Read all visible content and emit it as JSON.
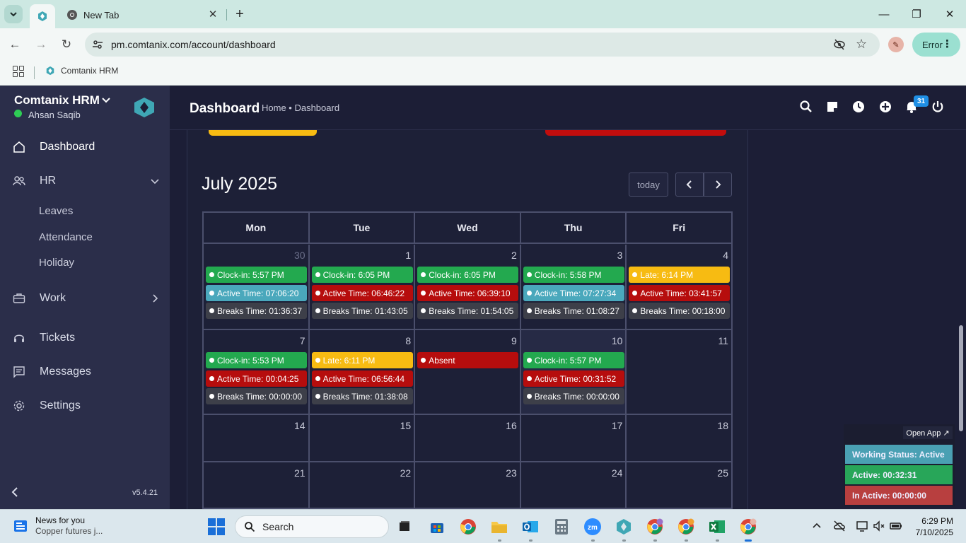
{
  "browser": {
    "tab_title": "New Tab",
    "url": "pm.comtanix.com/account/dashboard",
    "error_label": "Error",
    "bookmark": "Comtanix HRM"
  },
  "sidebar": {
    "brand": "Comtanix HRM",
    "user": "Ahsan Saqib",
    "items": [
      {
        "label": "Dashboard",
        "icon": "home-icon"
      },
      {
        "label": "HR",
        "icon": "users-icon"
      },
      {
        "label": "Leaves"
      },
      {
        "label": "Attendance"
      },
      {
        "label": "Holiday"
      },
      {
        "label": "Work",
        "icon": "briefcase-icon"
      },
      {
        "label": "Tickets",
        "icon": "headset-icon"
      },
      {
        "label": "Messages",
        "icon": "message-icon"
      },
      {
        "label": "Settings",
        "icon": "gear-icon"
      }
    ],
    "version": "v5.4.21"
  },
  "header": {
    "title": "Dashboard",
    "breadcrumb": "Home • Dashboard",
    "notification_count": "31"
  },
  "calendar": {
    "month": "July 2025",
    "today_label": "today",
    "weekdays": [
      "Mon",
      "Tue",
      "Wed",
      "Thu",
      "Fri"
    ],
    "weeks": [
      {
        "days": [
          {
            "num": "30",
            "events": [
              {
                "type": "green",
                "text": "Clock-in: 5:57 PM"
              },
              {
                "type": "teal",
                "text": "Active Time: 07:06:20"
              },
              {
                "type": "dark",
                "text": "Breaks Time: 01:36:37"
              }
            ]
          },
          {
            "num": "1",
            "events": [
              {
                "type": "green",
                "text": "Clock-in: 6:05 PM"
              },
              {
                "type": "red",
                "text": "Active Time: 06:46:22"
              },
              {
                "type": "dark",
                "text": "Breaks Time: 01:43:05"
              }
            ]
          },
          {
            "num": "2",
            "events": [
              {
                "type": "green",
                "text": "Clock-in: 6:05 PM"
              },
              {
                "type": "red",
                "text": "Active Time: 06:39:10"
              },
              {
                "type": "dark",
                "text": "Breaks Time: 01:54:05"
              }
            ]
          },
          {
            "num": "3",
            "events": [
              {
                "type": "green",
                "text": "Clock-in: 5:58 PM"
              },
              {
                "type": "teal",
                "text": "Active Time: 07:27:34"
              },
              {
                "type": "dark",
                "text": "Breaks Time: 01:08:27"
              }
            ]
          },
          {
            "num": "4",
            "events": [
              {
                "type": "yellow",
                "text": "Late: 6:14 PM"
              },
              {
                "type": "red",
                "text": "Active Time: 03:41:57"
              },
              {
                "type": "dark",
                "text": "Breaks Time: 00:18:00"
              }
            ]
          }
        ]
      },
      {
        "days": [
          {
            "num": "7",
            "events": [
              {
                "type": "green",
                "text": "Clock-in: 5:53 PM"
              },
              {
                "type": "red",
                "text": "Active Time: 00:04:25"
              },
              {
                "type": "dark",
                "text": "Breaks Time: 00:00:00"
              }
            ]
          },
          {
            "num": "8",
            "events": [
              {
                "type": "yellow",
                "text": "Late: 6:11 PM"
              },
              {
                "type": "red",
                "text": "Active Time: 06:56:44"
              },
              {
                "type": "dark",
                "text": "Breaks Time: 01:38:08"
              }
            ]
          },
          {
            "num": "9",
            "events": [
              {
                "type": "red",
                "text": "Absent"
              }
            ]
          },
          {
            "num": "10",
            "events": [
              {
                "type": "green",
                "text": "Clock-in: 5:57 PM"
              },
              {
                "type": "red",
                "text": "Active Time: 00:31:52"
              },
              {
                "type": "dark",
                "text": "Breaks Time: 00:00:00"
              }
            ]
          },
          {
            "num": "11",
            "events": []
          }
        ]
      },
      {
        "days": [
          {
            "num": "14",
            "events": []
          },
          {
            "num": "15",
            "events": []
          },
          {
            "num": "16",
            "events": []
          },
          {
            "num": "17",
            "events": []
          },
          {
            "num": "18",
            "events": []
          }
        ]
      },
      {
        "days": [
          {
            "num": "21",
            "events": []
          },
          {
            "num": "22",
            "events": []
          },
          {
            "num": "23",
            "events": []
          },
          {
            "num": "24",
            "events": []
          },
          {
            "num": "25",
            "events": []
          }
        ]
      }
    ]
  },
  "widget": {
    "open_app": "Open App ↗",
    "working_status": "Working Status: Active",
    "active": "Active: 00:32:31",
    "inactive": "In Active: 00:00:00"
  },
  "taskbar": {
    "news_title": "News for you",
    "news_sub": "Copper futures j...",
    "search_placeholder": "Search",
    "time": "6:29 PM",
    "date": "7/10/2025"
  },
  "colors": {
    "green": "#23a94f",
    "red": "#b60d0d",
    "teal": "#4aa8bc",
    "yellow": "#f7bb12",
    "dark": "#3d3f49"
  }
}
